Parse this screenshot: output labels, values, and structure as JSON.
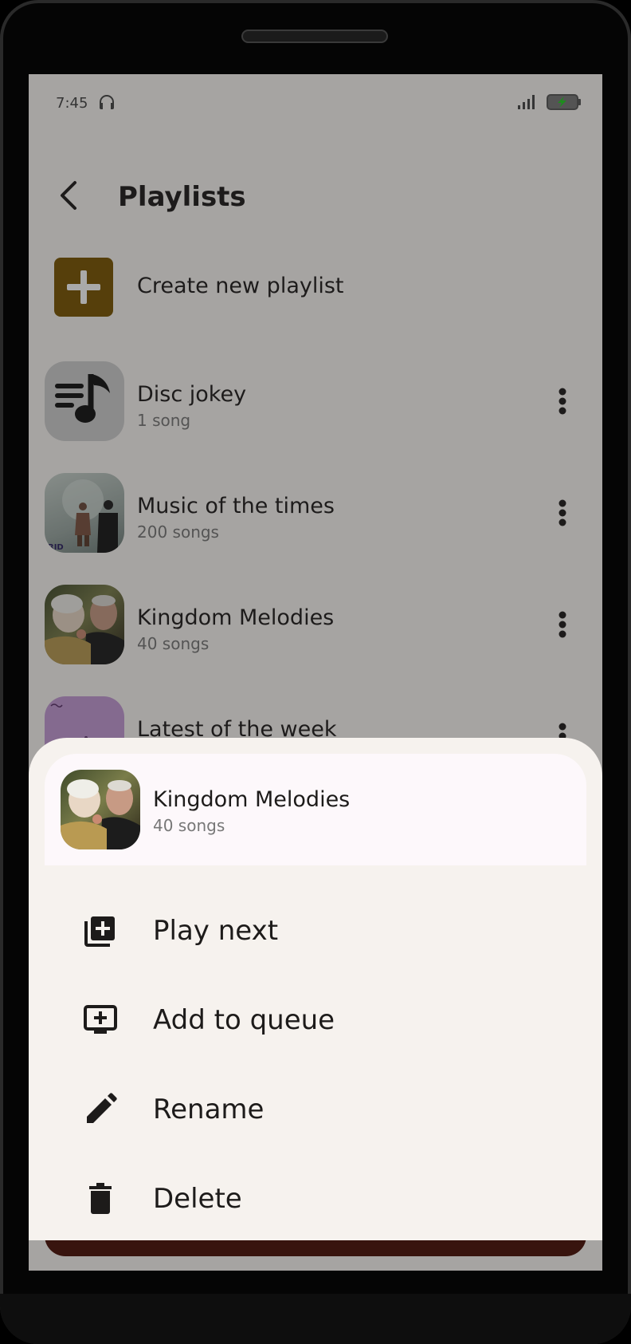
{
  "status": {
    "time": "7:45",
    "left_icon": "headphones-icon",
    "right_icons": [
      "signal-icon",
      "battery-charging-icon"
    ]
  },
  "header": {
    "title": "Playlists",
    "back_icon": "chevron-left-icon"
  },
  "create": {
    "label": "Create new playlist",
    "icon": "plus-icon",
    "tile_color": "#7a5500"
  },
  "playlists": [
    {
      "name": "Disc jokey",
      "count": "1 song"
    },
    {
      "name": "Music of the times",
      "count": "200 songs"
    },
    {
      "name": "Kingdom Melodies",
      "count": "40 songs"
    },
    {
      "name": "Latest of the week",
      "count": ""
    }
  ],
  "sheet": {
    "title": "Kingdom Melodies",
    "subtitle": "40 songs",
    "items": [
      {
        "label": "Play next",
        "icon": "playlist-add-icon"
      },
      {
        "label": "Add to queue",
        "icon": "add-to-queue-icon"
      },
      {
        "label": "Rename",
        "icon": "pencil-icon"
      },
      {
        "label": "Delete",
        "icon": "trash-icon"
      }
    ]
  },
  "colors": {
    "scrim": "rgba(30,28,30,0.38)",
    "sheet": "#f6f2ee",
    "miniplayer": "#4a0f06"
  }
}
